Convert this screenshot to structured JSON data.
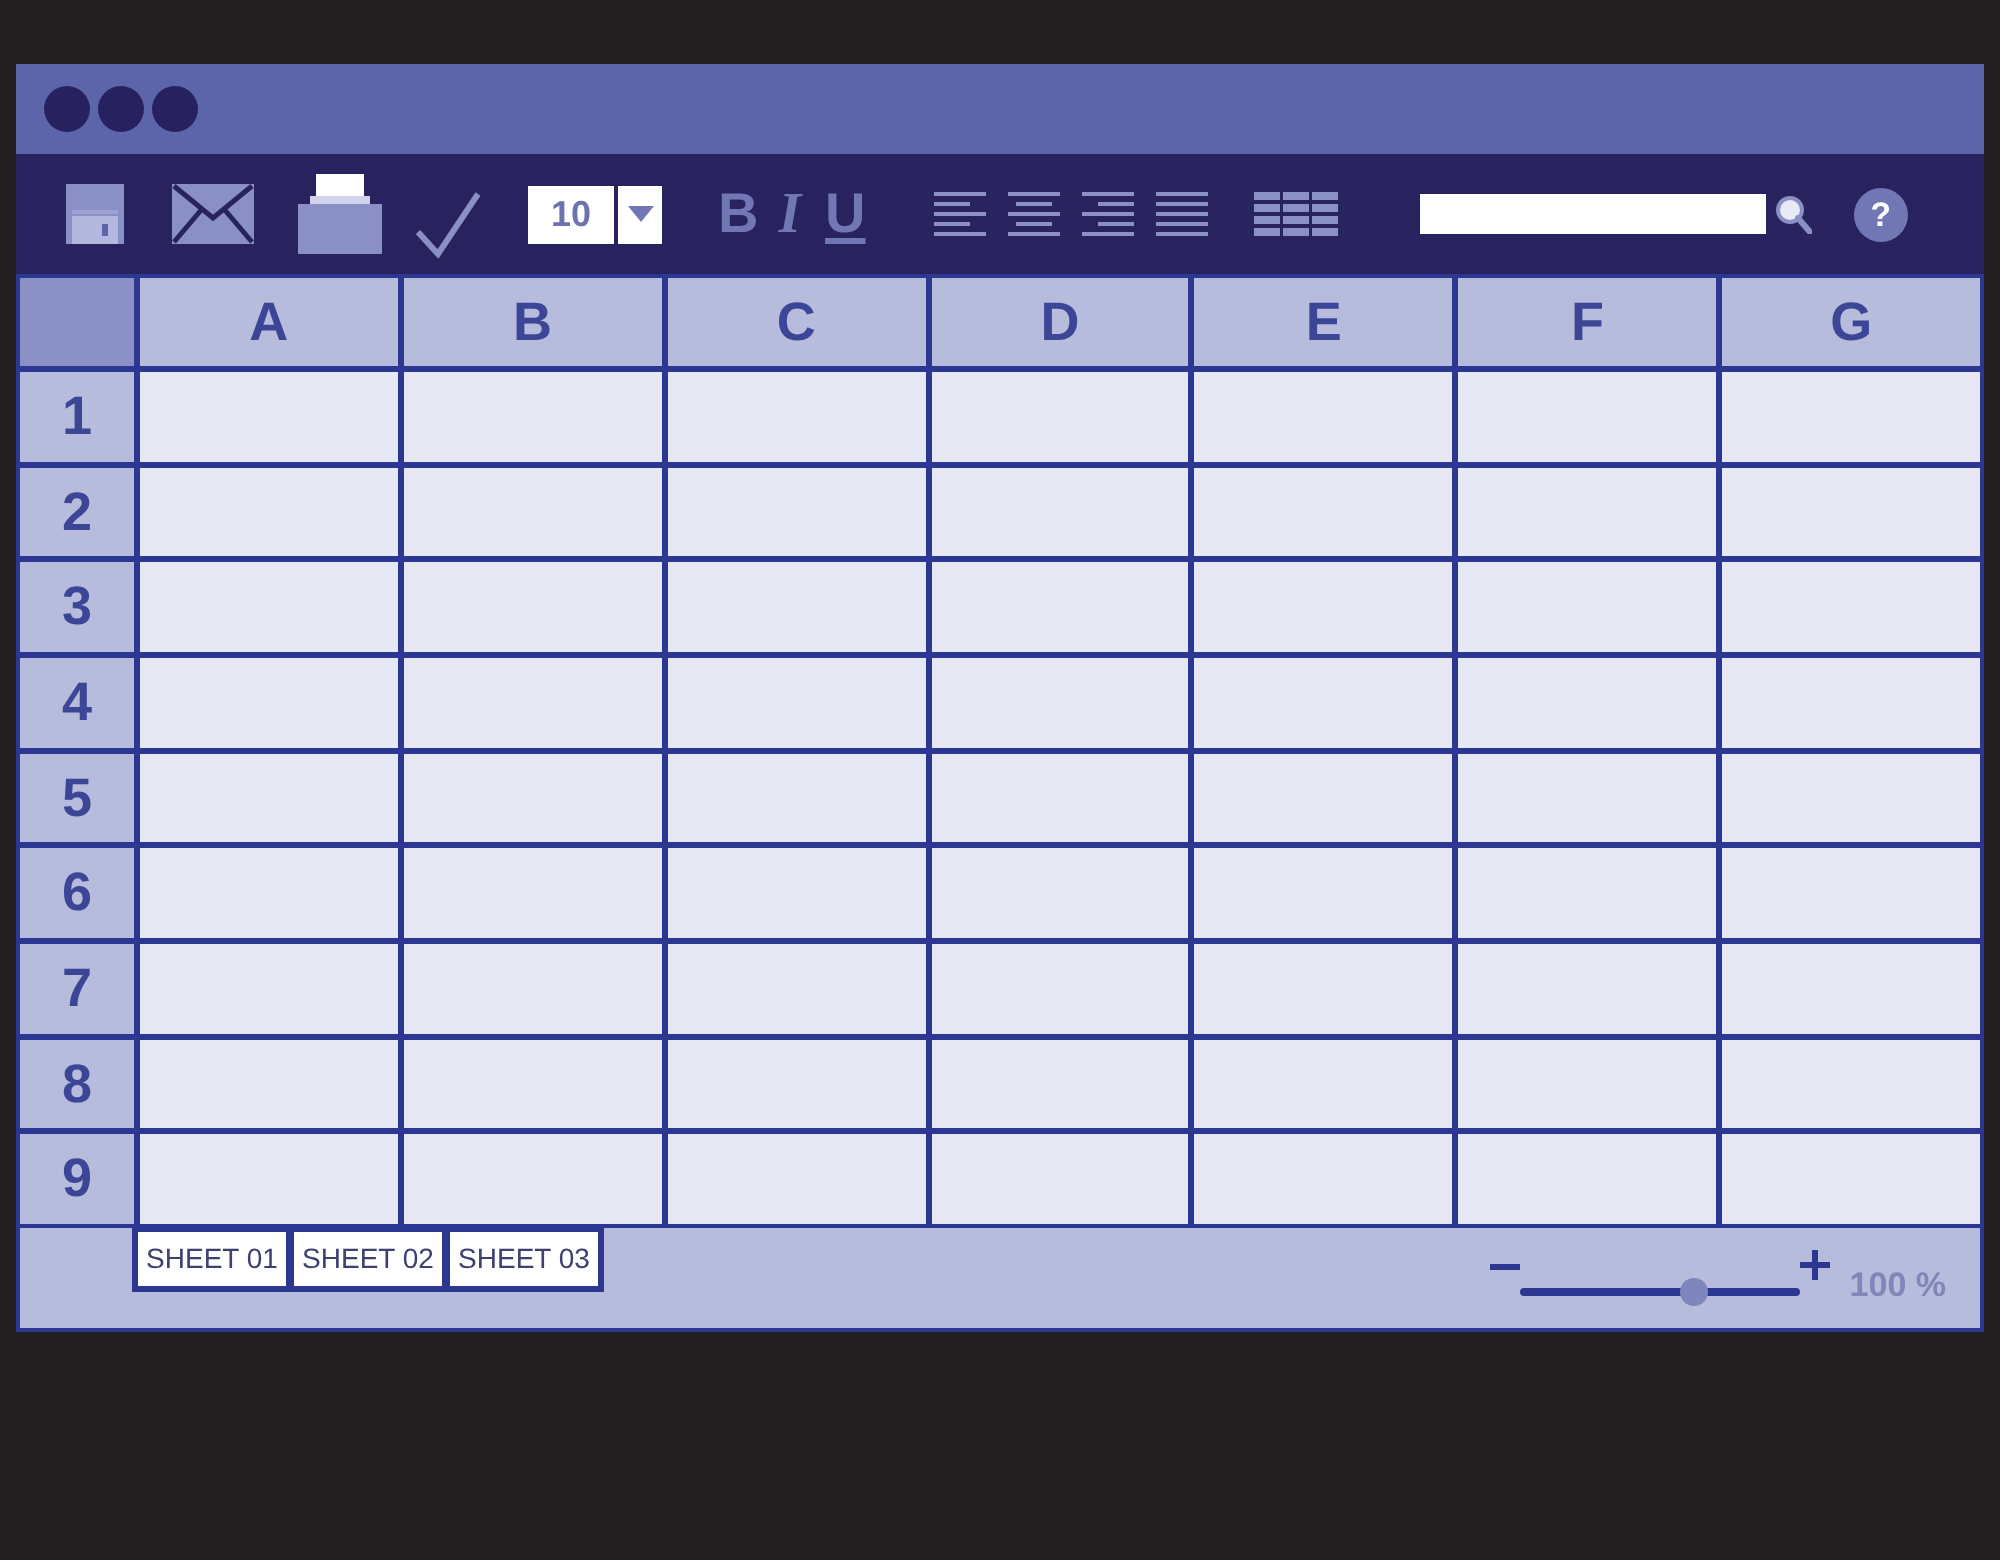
{
  "toolbar": {
    "font_size": {
      "value": "10"
    },
    "format_buttons": [
      {
        "kind": "bold",
        "label": "B"
      },
      {
        "kind": "italic",
        "label": "I"
      },
      {
        "kind": "underline",
        "label": "U"
      }
    ],
    "help": {
      "label": "?"
    }
  },
  "sheet": {
    "columns": [
      "A",
      "B",
      "C",
      "D",
      "E",
      "F",
      "G"
    ],
    "rows": [
      {
        "label": "1"
      },
      {
        "label": "2"
      },
      {
        "label": "3"
      },
      {
        "label": "4"
      },
      {
        "label": "5"
      },
      {
        "label": "6"
      },
      {
        "label": "7"
      },
      {
        "label": "8"
      },
      {
        "label": "9"
      }
    ]
  },
  "status_bar": {
    "sheet_tabs": [
      {
        "label": "SHEET 01",
        "selected": false
      },
      {
        "label": "SHEET 02",
        "selected": false
      },
      {
        "label": "SHEET 03",
        "selected": false
      }
    ],
    "zoom": {
      "level": 0.62,
      "reading": "100 %"
    }
  }
}
